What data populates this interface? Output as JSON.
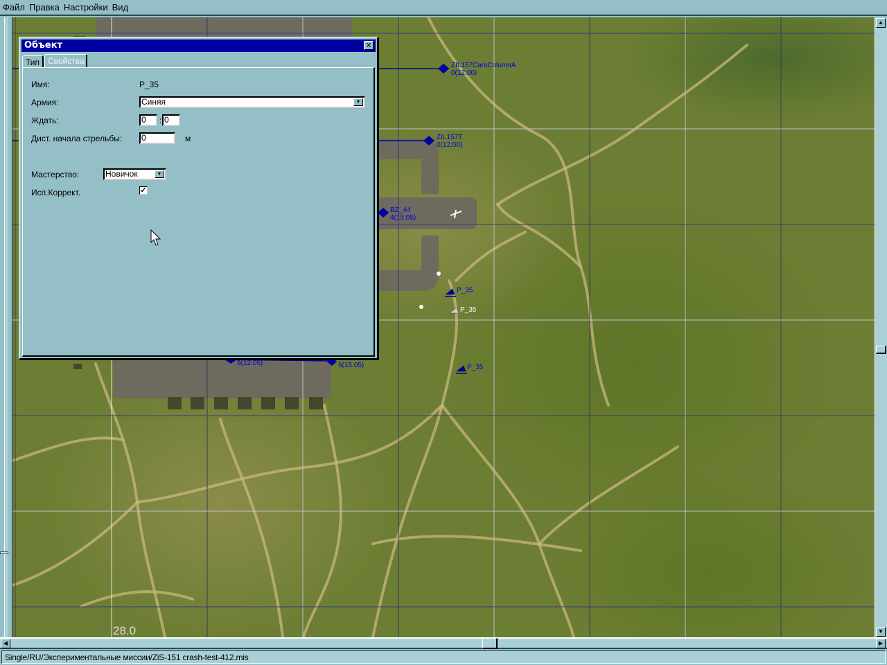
{
  "menu": {
    "items": [
      "Файл",
      "Правка",
      "Настройки",
      "Вид"
    ]
  },
  "map": {
    "scale_label": "28.0",
    "objects": [
      {
        "name": "ZIL157CarsColumnA",
        "info": "0(12:00)"
      },
      {
        "name": "ZIL157T",
        "info": "0(12:00)"
      },
      {
        "name": "BZ_44",
        "info": "4(15:05)"
      },
      {
        "name": "P_35",
        "info": ""
      },
      {
        "name": "P_35",
        "info": ""
      },
      {
        "name": "P_35",
        "info": ""
      }
    ],
    "waypoints": [
      "5(12:05)",
      "6(15:05)"
    ]
  },
  "dialog": {
    "title": "Объект",
    "close_icon": "close-icon",
    "tabs": [
      {
        "label": "Тип",
        "active": false
      },
      {
        "label": "Свойства",
        "active": true
      }
    ],
    "fields": {
      "name_label": "Имя:",
      "name_value": "P_35",
      "army_label": "Армия:",
      "army_value": "Синяя",
      "wait_label": "Ждать:",
      "wait_hours": "0",
      "wait_sep": ":",
      "wait_minutes": "0",
      "fire_dist_label": "Дист. начала стрельбы:",
      "fire_dist_value": "0",
      "fire_dist_unit": "м",
      "skill_label": "Мастерство:",
      "skill_value": "Новичок",
      "correction_label": "Исп.Коррект.",
      "correction_checked": true
    }
  },
  "status": {
    "path": "Single/RU/Экспериментальные миссии/ZiS-151  crash-test-412.mis"
  },
  "colors": {
    "title_bar": "#0000a0",
    "chrome": "#94bfc6",
    "map_label": "#0000e0"
  }
}
